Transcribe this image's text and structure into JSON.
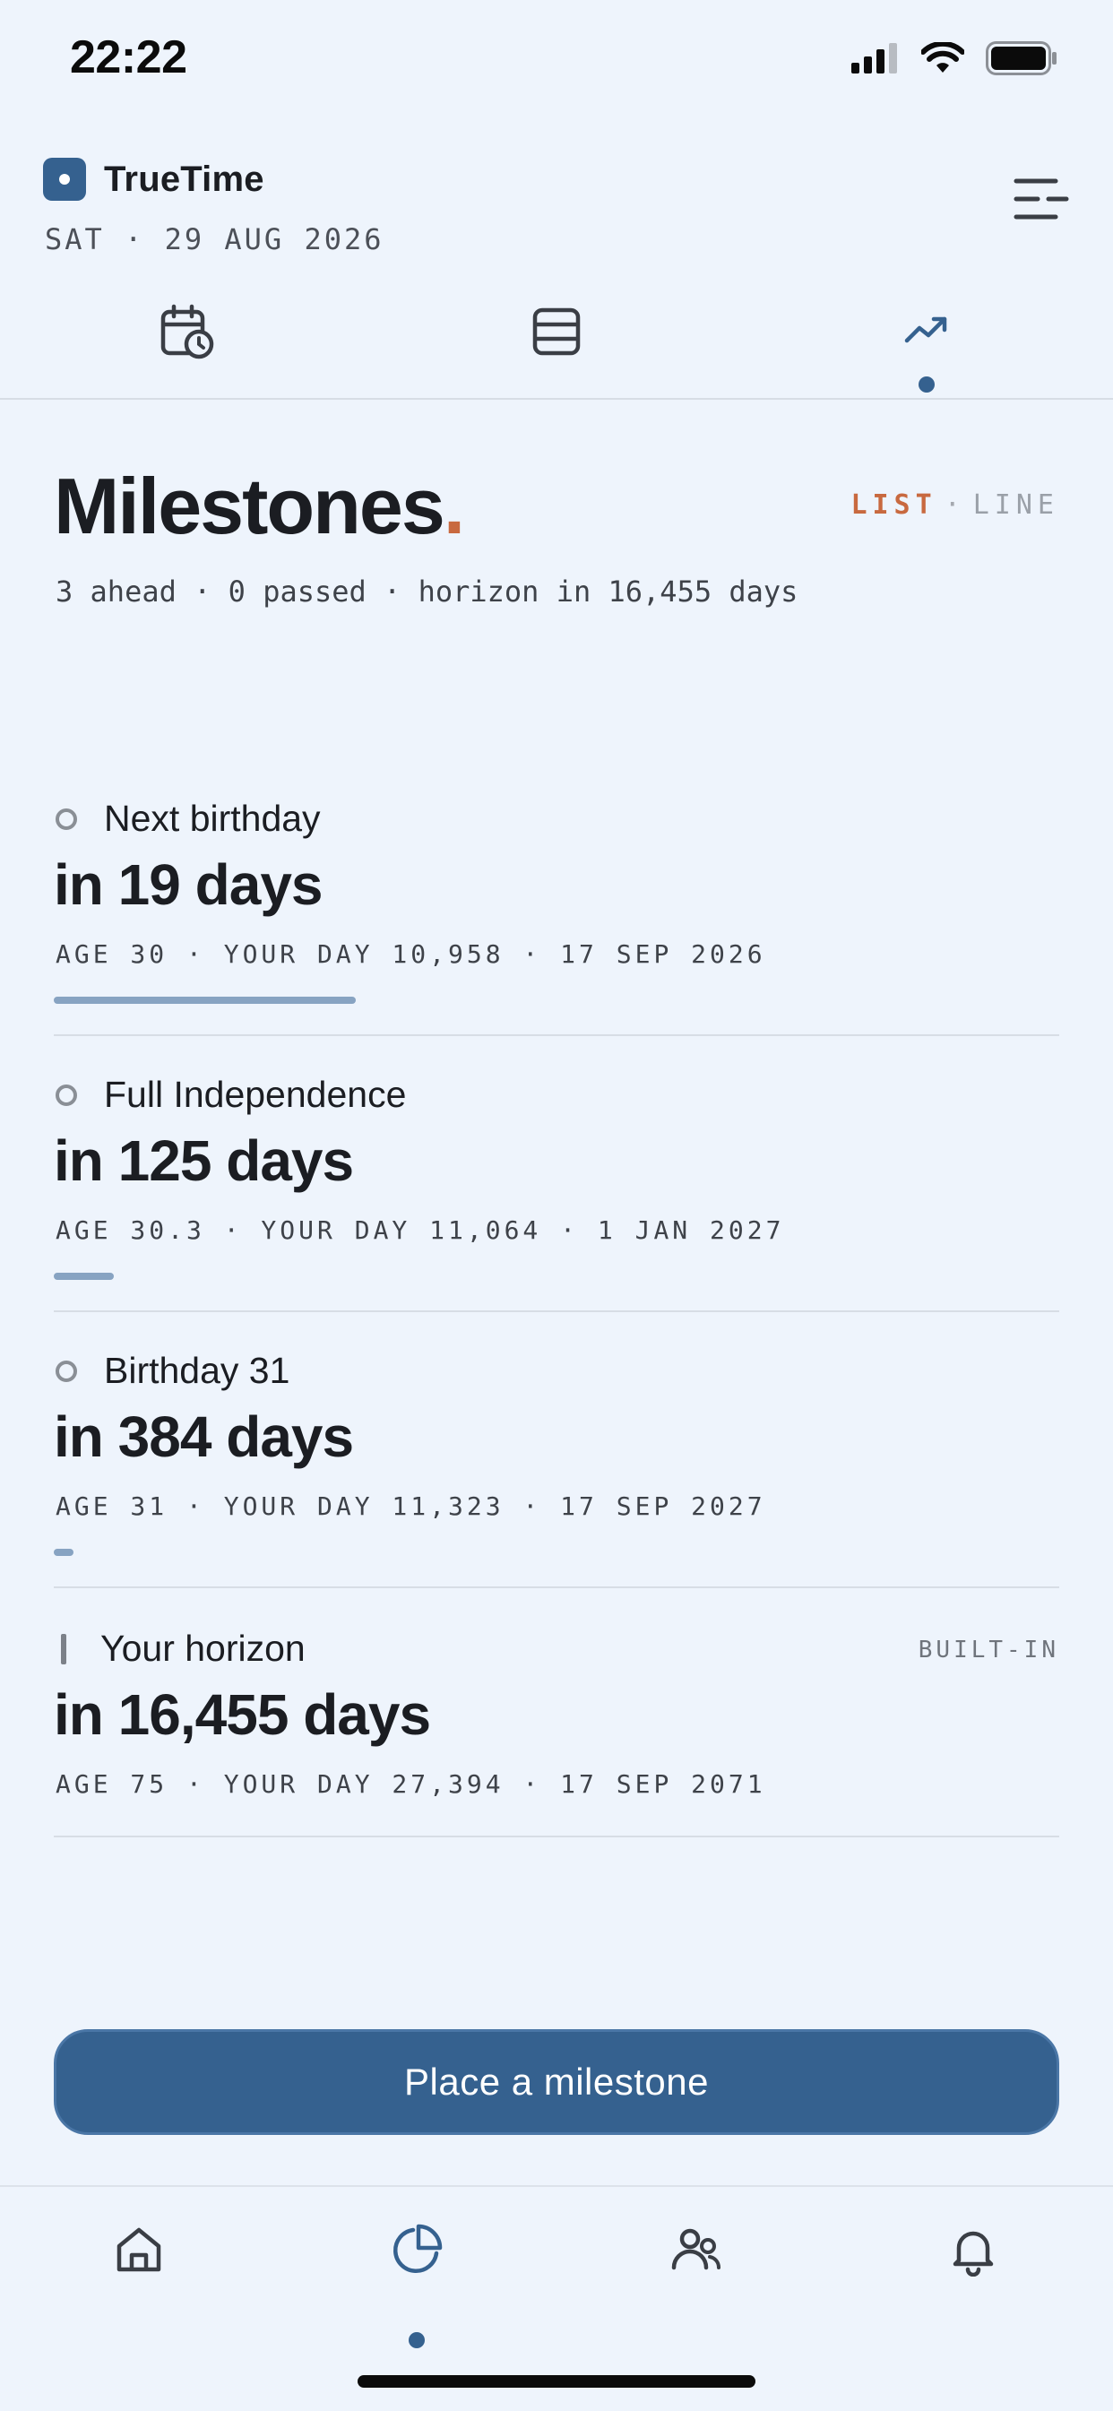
{
  "status_bar": {
    "time": "22:22"
  },
  "header": {
    "app_name": "TrueTime",
    "date": "SAT · 29 AUG 2026"
  },
  "top_tabs": [
    {
      "icon": "calendar-clock-icon",
      "active": false
    },
    {
      "icon": "list-rows-icon",
      "active": false
    },
    {
      "icon": "trend-up-icon",
      "active": true
    }
  ],
  "page": {
    "title": "Milestones",
    "title_period": ".",
    "view_toggle": {
      "list": "LIST",
      "separator": "·",
      "line": "LINE",
      "active": "LIST"
    },
    "summary": "3 ahead · 0 passed · horizon in 16,455 days"
  },
  "milestones": [
    {
      "name": "Next birthday",
      "countdown": "in 19 days",
      "meta": "AGE 30 · YOUR DAY 10,958 · 17 SEP 2026",
      "progress": 0.3,
      "marker": "ring",
      "tag": ""
    },
    {
      "name": "Full Independence",
      "countdown": "in 125 days",
      "meta": "AGE 30.3 · YOUR DAY 11,064 · 1 JAN 2027",
      "progress": 0.06,
      "marker": "ring",
      "tag": ""
    },
    {
      "name": "Birthday 31",
      "countdown": "in 384 days",
      "meta": "AGE 31 · YOUR DAY 11,323 · 17 SEP 2027",
      "progress": 0.02,
      "marker": "ring",
      "tag": ""
    },
    {
      "name": "Your horizon",
      "countdown": "in 16,455 days",
      "meta": "AGE 75 · YOUR DAY 27,394 · 17 SEP 2071",
      "progress": null,
      "marker": "bar",
      "tag": "BUILT-IN"
    }
  ],
  "cta": {
    "label": "Place a milestone"
  },
  "bottom_nav": [
    {
      "icon": "home-icon",
      "active": false
    },
    {
      "icon": "pie-chart-icon",
      "active": true
    },
    {
      "icon": "people-icon",
      "active": false
    },
    {
      "icon": "bell-icon",
      "active": false
    }
  ],
  "colors": {
    "accent": "#35618F",
    "highlight": "#C8693F",
    "background": "#EEF4FC",
    "progress": "#87A3C2"
  }
}
